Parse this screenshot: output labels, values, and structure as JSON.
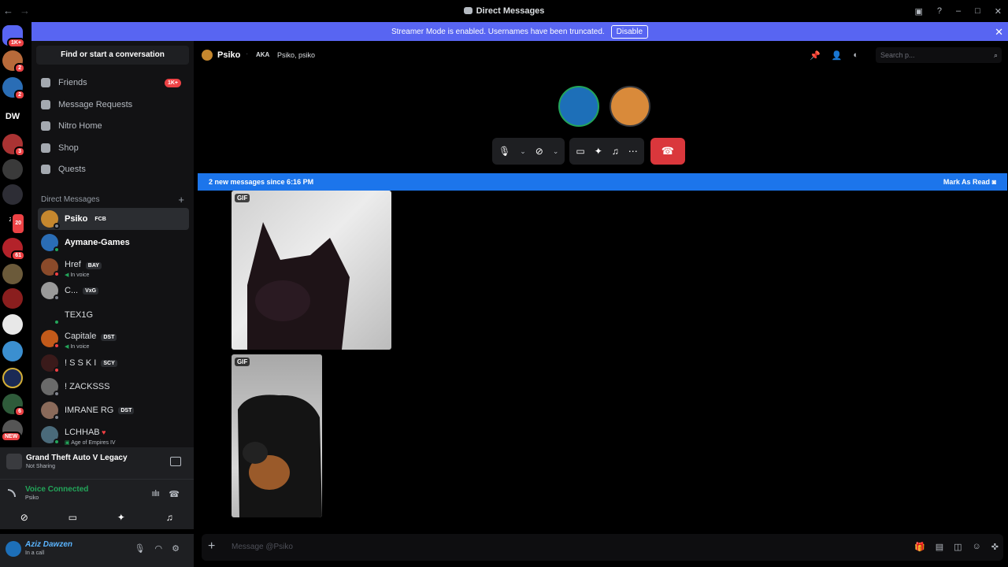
{
  "window": {
    "title": "Direct Messages"
  },
  "banner": {
    "text": "Streamer Mode is enabled. Usernames have been truncated.",
    "button": "Disable"
  },
  "servers": {
    "home_badge": "1K+",
    "dw_label": "DW",
    "badges": [
      "2",
      "2",
      "3",
      "20",
      "61",
      "6"
    ],
    "new_label": "NEW",
    "za_label": "ZA"
  },
  "sidebar": {
    "search_label": "Find or start a conversation",
    "nav": [
      {
        "label": "Friends",
        "badge": "1K+"
      },
      {
        "label": "Message Requests"
      },
      {
        "label": "Nitro Home"
      },
      {
        "label": "Shop"
      },
      {
        "label": "Quests"
      }
    ],
    "dm_header": "Direct Messages",
    "dms": [
      {
        "name": "Psiko",
        "tag": "FCB"
      },
      {
        "name": "Aymane-Games",
        "tag": ""
      },
      {
        "name": "Href",
        "tag": "BAY",
        "sub": "In voice"
      },
      {
        "name": "C...",
        "tag": "VxG"
      },
      {
        "name": "TEX1G",
        "tag": ""
      },
      {
        "name": "Capitale",
        "tag": "DST",
        "sub": "In voice"
      },
      {
        "name": "! S S K I",
        "tag": "SCY"
      },
      {
        "name": "! ZACKSSS",
        "tag": ""
      },
      {
        "name": "IMRANE RG",
        "tag": "DST"
      },
      {
        "name": "LCHHAB",
        "tag": "",
        "sub": "Age of Empires IV"
      }
    ]
  },
  "activity": {
    "title": "Grand Theft Auto V Legacy",
    "status": "Not Sharing"
  },
  "voice": {
    "status": "Voice Connected",
    "channel": "Psiko"
  },
  "user": {
    "name": "Aziz Dawzen",
    "status": "In a call"
  },
  "chat": {
    "name": "Psiko",
    "aka_label": "AKA",
    "aliases": "Psiko, psiko",
    "search_placeholder": "Search p...",
    "new_messages": "2 new messages since 6:16 PM",
    "mark_read": "Mark As Read",
    "gif_label": "GIF",
    "composer_placeholder": "Message @Psiko"
  },
  "colors": {
    "blurple": "#5865f2",
    "online": "#23a55a",
    "danger": "#da373c",
    "newbar": "#1c75eb"
  }
}
